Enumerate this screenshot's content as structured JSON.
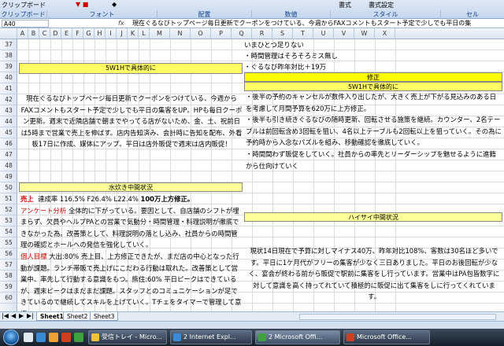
{
  "ribbon": {
    "buttons": [
      "クリップボード",
      "フォント",
      "配置",
      "数値",
      "書式",
      "書式設定",
      "スタイル",
      "セル"
    ],
    "groups": [
      "クリップボード",
      "フォント",
      "配置",
      "数値",
      "スタイル",
      "セル"
    ]
  },
  "formula_bar": {
    "name_box": "A40",
    "fx": "fx",
    "formula": "現在ぐるなびトップページ毎日更新でクーポンをつけている、今週からFAXコメントもスタート予定で少しでも平日の集"
  },
  "columns": [
    "A",
    "B",
    "C",
    "D",
    "E",
    "F",
    "G",
    "H",
    "I",
    "J",
    "K",
    "L",
    "M",
    "N",
    "O",
    "P",
    "Q",
    "R",
    "S",
    "T",
    "U",
    "V",
    "W",
    "X"
  ],
  "rows": [
    "37",
    "38",
    "39",
    "40",
    "41",
    "42",
    "43",
    "44",
    "45",
    "46",
    "47",
    "48",
    "49",
    "50",
    "51",
    "52",
    "53",
    "54",
    "55",
    "56",
    "57",
    "58",
    "59",
    "60",
    "61",
    "62",
    "63",
    "64",
    "65",
    "66"
  ],
  "sheet": {
    "right_top": [
      "いまひとつ足りない",
      "・時間管理はそろそろミス無し",
      "・ぐるなび昨年対比＋19万"
    ],
    "left_header_1": "5W1Hで具体的に",
    "right_header_1": "修正",
    "right_header_2": "5W1Hで具体的に",
    "left_block_1": "現在ぐるなびトップページ毎日更新でクーポンをつけている、今週からFAXコメントもスタート予定で少しでも平日の集客をUP。HPも毎日クーポン更新。週末で近隣店舗で朝までやってる店がないため、金、土、祝前日は5時まで営業で売上を伸ばす。店内告知済み、会計時に告知を配布、外看板17日に作成、媒体にアップ。平日は店外販促で週末は店内販促！",
    "right_block_1": "・後半の予約のキャンセルが数件入り出したが、大きく売上が下がる見込みのある日を考慮して月間予算を620万に上方修正。\n・後半も引き続きぐるなびの随時更新、回転させる施策を継続。カウンター、2名テーブルは前回転含め3回転を狙い、4名以上テーブルも2回転以上を狙っていく。その為に予約時から入念なパズルを組み、移動確認を徹底していく。\n・時間間わず販促をしていく。社員からの率先とリーダーシップを魅せるように進籍から仕向けていく",
    "left_header_2": "水炊き中間状況",
    "right_header_3": "ハイサイ中間状況",
    "sales_label": "売上",
    "sales_text": "達成率 116.5% F26.4% L22.4%",
    "sales_highlight": "100万上方修正。",
    "questionnaire_label": "アンケート分析",
    "questionnaire_text": "全体的に下がっている。要因として、自店舗のシフトが埋まらず、欠員やヘルプPAとの営業で気動分・時間管理・料理説明が徹底できなかった為。改善策として、料理説明の落とし込み、社員からの時間管理の確認とホールへの発信を強化していく。",
    "personal_label": "個人目標",
    "personal_text": "大出:80% 売上目、上方修正できたが、まだ店の中心となった行動が課題。ランチ帯販で売上げにこだわる行動は取れた。改善策として営業中、率先して行動する意識をもつ。熊住:60% 平日ピークはできているが、週末ピークはまだまだ課題。スタッフとのコミュニケーションが足できているので継続してスキルを上げていく。Tチェをタイマーで管理して意識",
    "right_block_2": "現状14日現在で予算に対しマイナス40万、昨年対比108%、客数は30名ほど多いです。平日に1ケ月代がフリーの集客が少なく三日ありました。平日のお後回転が少なく、宴会が終わる前から販促で駅前に集客をし行っています。営業中はPA包皆数字に対して意識を高く持ってれていて積極的に販促に出て集客をしに行ってくれています。"
  },
  "tabs": [
    "Sheet1",
    "Sheet2",
    "Sheet3"
  ],
  "taskbar": {
    "items": [
      "受信トレイ - Micro...",
      "2 Internet Expl...",
      "2 Microsoft Offi...",
      "Microsoft Office..."
    ]
  }
}
